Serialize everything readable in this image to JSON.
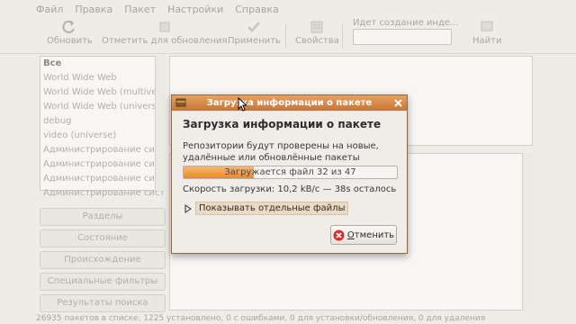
{
  "menubar": {
    "items": [
      {
        "label": "Файл"
      },
      {
        "label": "Правка"
      },
      {
        "label": "Пакет"
      },
      {
        "label": "Настройки"
      },
      {
        "label": "Справка"
      }
    ]
  },
  "toolbar": {
    "reload_label": "Обновить",
    "mark_upgrades_label": "Отметить для обновления",
    "apply_label": "Применить",
    "properties_label": "Свойства",
    "search_hint": "Идет создание инде...",
    "search_value": "",
    "search_button_label": "Найти"
  },
  "categories": [
    {
      "label": "Все"
    },
    {
      "label": "World Wide Web"
    },
    {
      "label": "World Wide Web (multiverse)"
    },
    {
      "label": "World Wide Web (universe)"
    },
    {
      "label": "debug"
    },
    {
      "label": "video (universe)"
    },
    {
      "label": "Администрирование системы"
    },
    {
      "label": "Администрирование системы"
    },
    {
      "label": "Администрирование системы"
    },
    {
      "label": "Администрирование системы"
    }
  ],
  "filters": {
    "sections": "Разделы",
    "status": "Состояние",
    "origin": "Происхождение",
    "custom_filters": "Специальные фильтры",
    "search_results": "Результаты поиска"
  },
  "statusbar": {
    "text": "26935 пакетов в списке, 1225 установлено, 0 с ошибками, 0 для установки/обновления, 0 для удаления"
  },
  "dialog": {
    "title": "Загрузка информации о пакете",
    "heading": "Загрузка информации о пакете",
    "description": "Репозитории будут проверены на новые, удалённые или обновлённые пакеты программ.",
    "progress": {
      "fraction": 0.33,
      "text": "Загружается файл 32 из 47"
    },
    "speed_text": "Скорость загрузки: 10,2 kB/c — 38s осталось",
    "expander_label": "Показывать отдельные файлы",
    "cancel_label": "Отменить"
  },
  "colors": {
    "titlebar_accent": "#d9844a",
    "progress_fill": "#ee9a45",
    "cancel_icon": "#d32f2f"
  }
}
